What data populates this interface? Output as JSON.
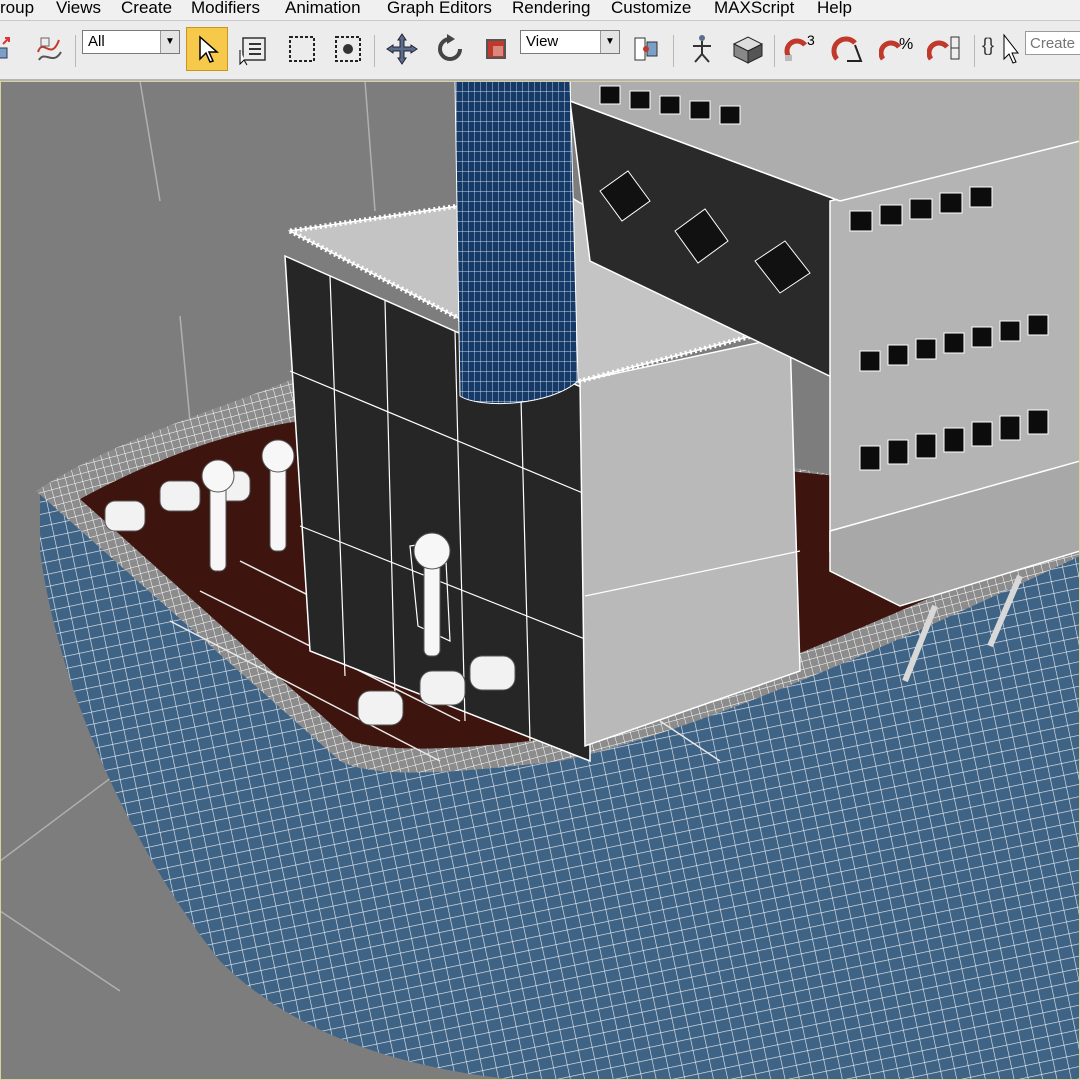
{
  "menubar": {
    "items": [
      "roup",
      "Views",
      "Create",
      "Modifiers",
      "Animation",
      "Graph Editors",
      "Rendering",
      "Customize",
      "MAXScript",
      "Help"
    ]
  },
  "toolbar": {
    "selection_filter": "All",
    "reference_coord": "View",
    "create_selection_set_placeholder": "Create S",
    "angle_snap_superscript": "3",
    "percent_snap_symbol": "%",
    "icons": [
      "select-link-icon",
      "bind-space-warp-icon",
      "select-object-icon",
      "select-by-name-icon",
      "rectangular-selection-icon",
      "window-crossing-icon",
      "move-icon",
      "rotate-icon",
      "scale-icon",
      "pivot-center-icon",
      "manipulate-icon",
      "keyboard-shortcut-icon",
      "snap-toggle-icon",
      "angle-snap-icon",
      "percent-snap-icon",
      "spinner-snap-icon",
      "edit-named-selection-icon"
    ]
  },
  "viewport": {
    "type": "perspective",
    "model": "ship stern wireframe",
    "colors": {
      "background": "#7d7d7d",
      "hull": "#3f6385",
      "deck": "#3d150e",
      "superstructure_light": "#b9b9b9",
      "superstructure_dark": "#262626",
      "funnel": "#163a68",
      "wire": "#ffffff",
      "accent_border": "#d7d19a"
    }
  }
}
